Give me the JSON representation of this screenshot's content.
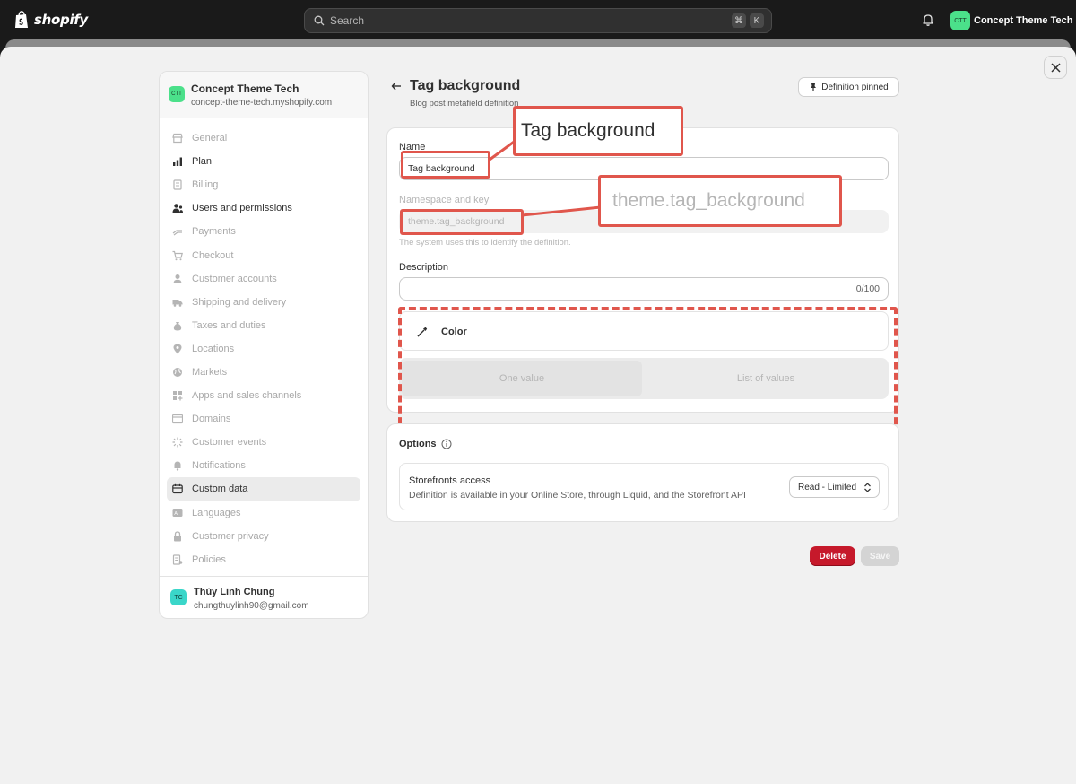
{
  "topbar": {
    "logo_text": "shopify",
    "search_placeholder": "Search",
    "shortcut_key1": "⌘",
    "shortcut_key2": "K",
    "store_initials": "CTT",
    "store_name": "Concept Theme Tech"
  },
  "sidebar": {
    "store_initials": "CTT",
    "store_name": "Concept Theme Tech",
    "store_domain": "concept-theme-tech.myshopify.com",
    "items": [
      {
        "label": "General",
        "icon": "store-icon",
        "state": "dim"
      },
      {
        "label": "Plan",
        "icon": "chart-icon",
        "state": "active"
      },
      {
        "label": "Billing",
        "icon": "billing-icon",
        "state": "dim"
      },
      {
        "label": "Users and permissions",
        "icon": "users-icon",
        "state": "active"
      },
      {
        "label": "Payments",
        "icon": "payments-icon",
        "state": "dim"
      },
      {
        "label": "Checkout",
        "icon": "cart-icon",
        "state": "dim"
      },
      {
        "label": "Customer accounts",
        "icon": "person-icon",
        "state": "dim"
      },
      {
        "label": "Shipping and delivery",
        "icon": "truck-icon",
        "state": "dim"
      },
      {
        "label": "Taxes and duties",
        "icon": "tax-icon",
        "state": "dim"
      },
      {
        "label": "Locations",
        "icon": "location-icon",
        "state": "dim"
      },
      {
        "label": "Markets",
        "icon": "globe-icon",
        "state": "dim"
      },
      {
        "label": "Apps and sales channels",
        "icon": "apps-icon",
        "state": "dim"
      },
      {
        "label": "Domains",
        "icon": "domain-icon",
        "state": "dim"
      },
      {
        "label": "Customer events",
        "icon": "events-icon",
        "state": "dim"
      },
      {
        "label": "Notifications",
        "icon": "bell-icon",
        "state": "dim"
      },
      {
        "label": "Custom data",
        "icon": "data-icon",
        "state": "selected"
      },
      {
        "label": "Languages",
        "icon": "language-icon",
        "state": "dim"
      },
      {
        "label": "Customer privacy",
        "icon": "lock-icon",
        "state": "dim"
      },
      {
        "label": "Policies",
        "icon": "policy-icon",
        "state": "dim"
      }
    ],
    "user_initials": "TC",
    "user_name": "Thùy Linh Chung",
    "user_email": "chungthuylinh90@gmail.com"
  },
  "header": {
    "title": "Tag background",
    "subtitle": "Blog post metafield definition",
    "pin_label": "Definition pinned"
  },
  "form": {
    "name_label": "Name",
    "name_value": "Tag background",
    "namespace_label": "Namespace and key",
    "namespace_value": "theme.tag_background",
    "namespace_helper": "The system uses this to identify the definition.",
    "description_label": "Description",
    "description_counter": "0/100",
    "type_label": "Color",
    "value_options": [
      "One value",
      "List of values"
    ],
    "selected_option": "One value"
  },
  "annotations": {
    "callout_name": "Tag background",
    "callout_key": "theme.tag_background",
    "accent_color": "#e0564c"
  },
  "options": {
    "title": "Options",
    "storefront_title": "Storefronts access",
    "storefront_desc": "Definition is available in your Online Store, through Liquid, and the Storefront API",
    "storefront_value": "Read - Limited"
  },
  "actions": {
    "delete_label": "Delete",
    "save_label": "Save"
  }
}
